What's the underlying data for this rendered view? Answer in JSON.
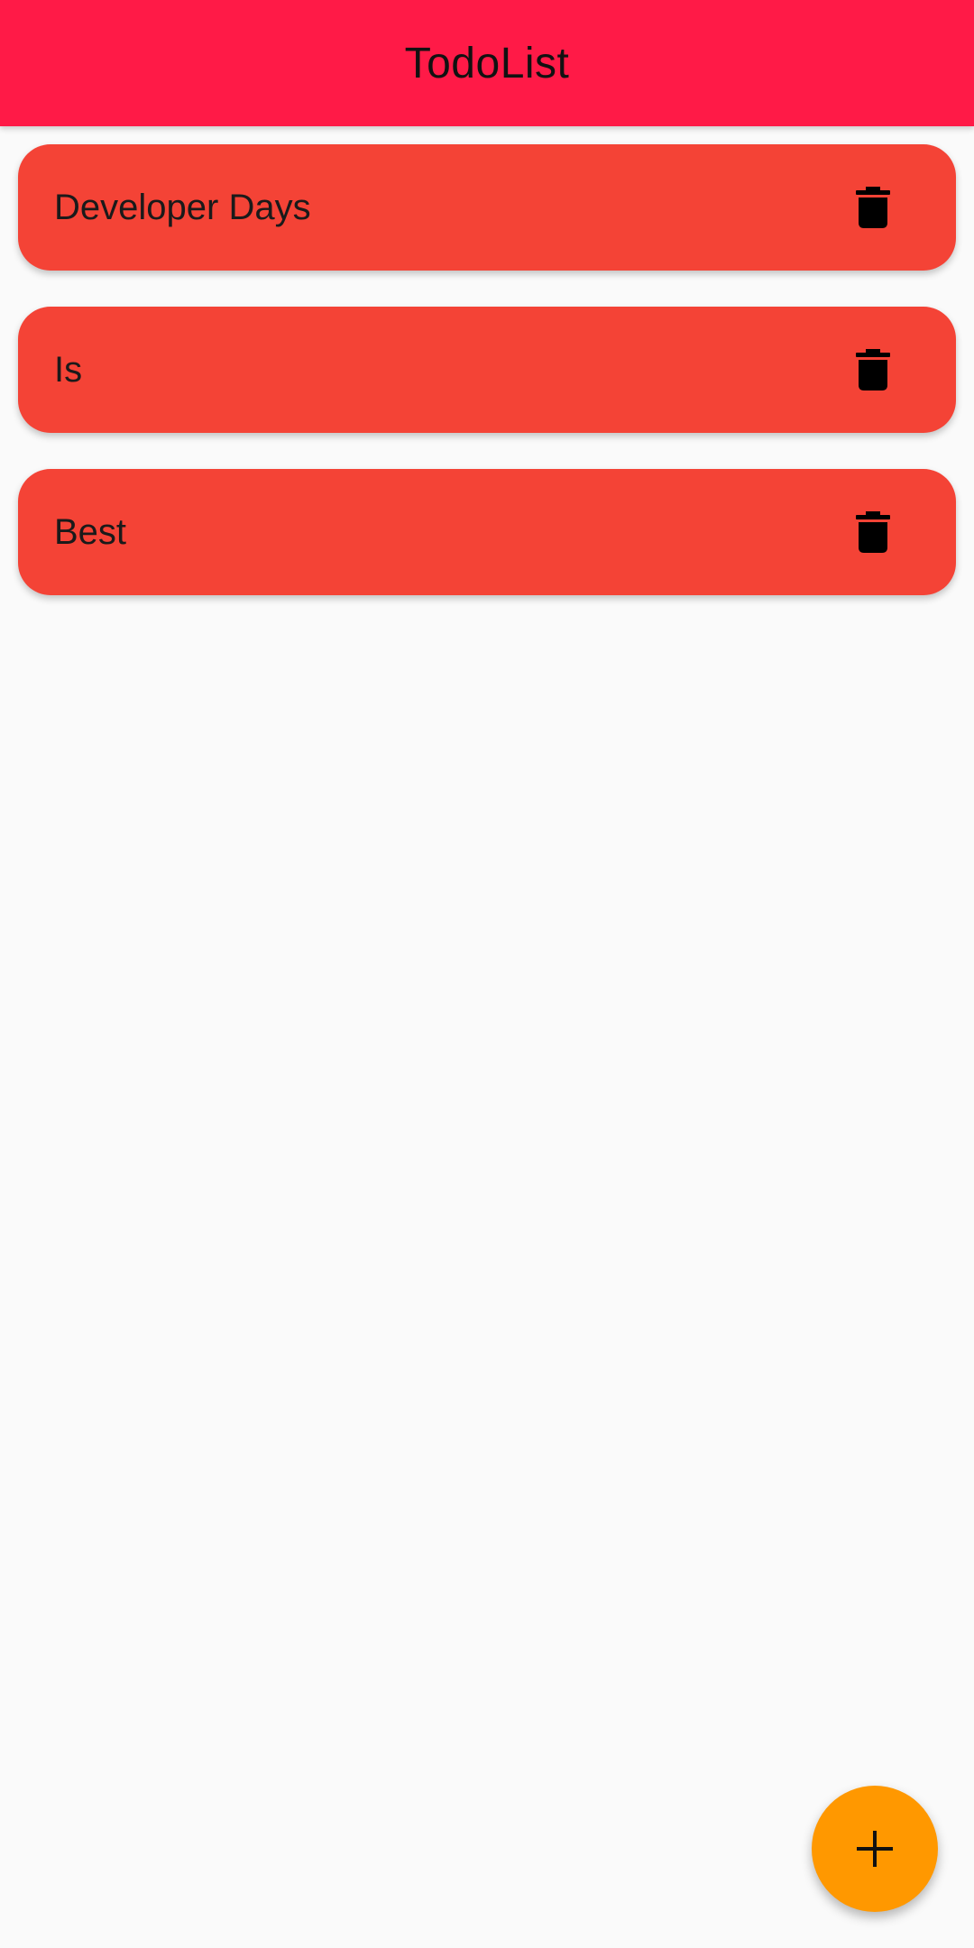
{
  "app_bar": {
    "title": "TodoList"
  },
  "todos": [
    {
      "label": "Developer Days"
    },
    {
      "label": "Is"
    },
    {
      "label": "Best"
    }
  ],
  "icons": {
    "delete": "trash-icon",
    "add": "plus-icon"
  },
  "colors": {
    "app_bar": "#ff1a47",
    "card": "#f44336",
    "fab": "#ff9800",
    "background": "#fafafa"
  }
}
